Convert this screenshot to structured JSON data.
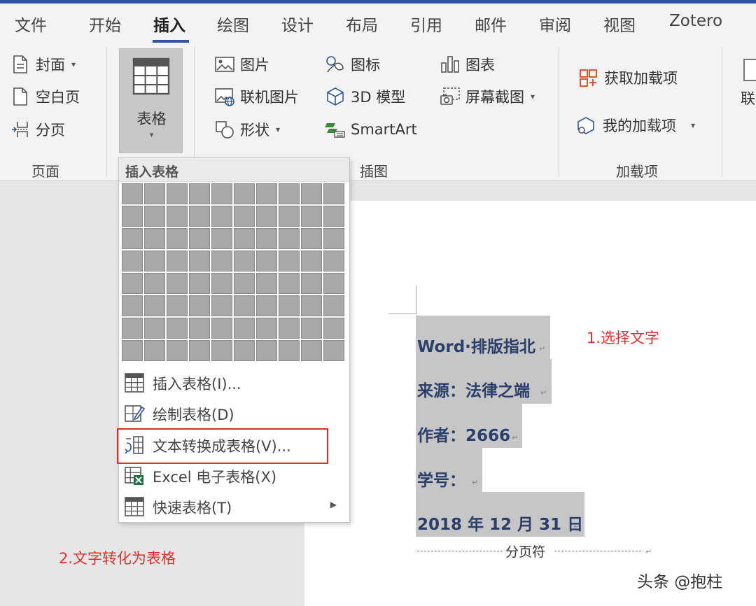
{
  "tabs": [
    "文件",
    "开始",
    "插入",
    "绘图",
    "设计",
    "布局",
    "引用",
    "邮件",
    "审阅",
    "视图",
    "Zotero"
  ],
  "active_tab": "插入",
  "ribbon": {
    "pages_group": {
      "label": "页面",
      "cover": "封面",
      "blank_page": "空白页",
      "page_break": "分页"
    },
    "table_button": "表格",
    "illustrations_group": {
      "label": "插图",
      "pictures": "图片",
      "online_pictures": "联机图片",
      "shapes": "形状",
      "icons": "图标",
      "models_3d": "3D 模型",
      "smartart": "SmartArt",
      "chart": "图表",
      "screenshot": "屏幕截图"
    },
    "addins_group": {
      "label": "加载项",
      "get_addins": "获取加载项",
      "my_addins": "我的加载项"
    },
    "partial_button": "联机"
  },
  "insert_table_menu": {
    "title": "插入表格",
    "grid_cols": 10,
    "grid_rows": 8,
    "items": [
      {
        "label": "插入表格(I)..."
      },
      {
        "label": "绘制表格(D)"
      },
      {
        "label": "文本转换成表格(V)..."
      },
      {
        "label": "Excel 电子表格(X)"
      },
      {
        "label": "快速表格(T)"
      }
    ]
  },
  "document": {
    "lines": [
      "Word·排版指北",
      "来源：法律之端",
      "作者：2666",
      "学号：",
      "2018 年 12 月 31 日"
    ],
    "page_break_label": "分页符"
  },
  "annotations": {
    "step1": "1.选择文字",
    "step2": "2.文字转化为表格"
  },
  "watermark": "头条 @抱柱",
  "colors": {
    "accent": "#2b579a",
    "annotation": "#e03030",
    "doc_text": "#2a3f6a",
    "selection": "#c6c6c6"
  }
}
